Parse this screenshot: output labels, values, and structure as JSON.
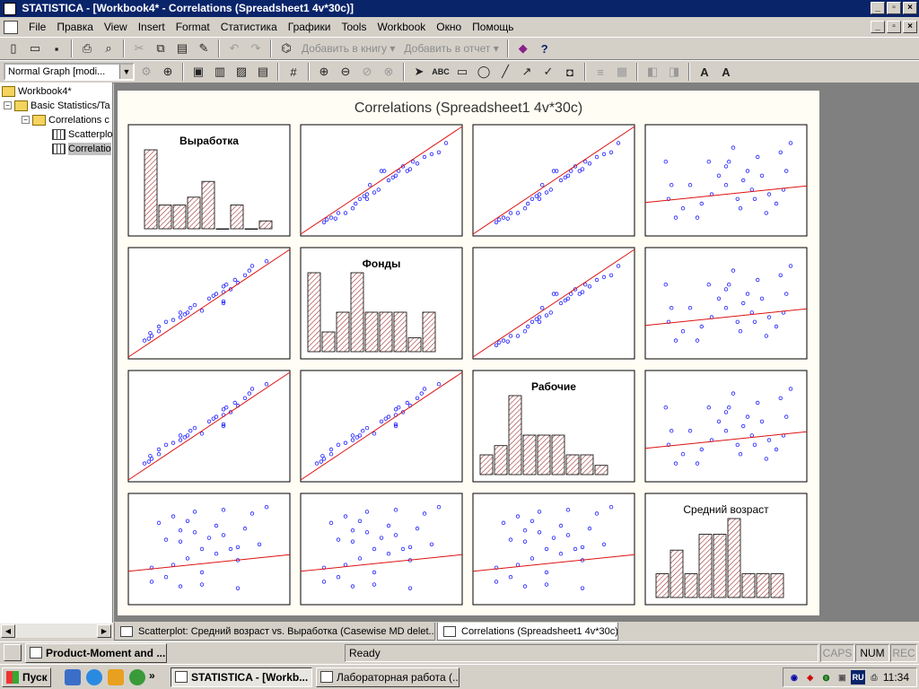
{
  "titlebar": {
    "title": "STATISTICA - [Workbook4* - Correlations (Spreadsheet1 4v*30c)]"
  },
  "menu": [
    "File",
    "Правка",
    "View",
    "Insert",
    "Format",
    "Статистика",
    "Графики",
    "Tools",
    "Workbook",
    "Окно",
    "Помощь"
  ],
  "toolbar1": {
    "add_to_workbook": "Добавить в книгу ▾",
    "add_to_report": "Добавить в отчет ▾"
  },
  "toolbar2": {
    "graph_style": "Normal Graph [modi..."
  },
  "tree": {
    "root": "Workbook4*",
    "basic_stats": "Basic Statistics/Ta",
    "correlations_folder": "Correlations c",
    "scatterplot": "Scatterplo",
    "correlations": "Correlatio"
  },
  "graph": {
    "title": "Correlations (Spreadsheet1 4v*30c)"
  },
  "chart_data": {
    "type": "scatter",
    "title": "Correlations (Spreadsheet1 4v*30c)",
    "variables": [
      "Выработка",
      "Фонды",
      "Рабочие",
      "Средний возраст"
    ],
    "histograms": [
      {
        "variable": "Выработка",
        "counts": [
          10,
          3,
          3,
          4,
          6,
          0,
          3,
          0,
          1
        ]
      },
      {
        "variable": "Фонды",
        "counts": [
          4,
          1,
          2,
          4,
          2,
          2,
          2,
          0.7,
          2
        ]
      },
      {
        "variable": "Рабочие",
        "counts": [
          1.5,
          2.2,
          6,
          3.0,
          3.0,
          3.0,
          1.5,
          1.5,
          0.7
        ]
      },
      {
        "variable": "Средний возраст",
        "counts": [
          1.5,
          3,
          1.5,
          4,
          4,
          5,
          1.5,
          1.5,
          1.5
        ]
      }
    ],
    "scatter_points": [
      [
        0.1,
        0.05
      ],
      [
        0.12,
        0.08
      ],
      [
        0.15,
        0.1
      ],
      [
        0.18,
        0.09
      ],
      [
        0.2,
        0.15
      ],
      [
        0.25,
        0.15
      ],
      [
        0.3,
        0.2
      ],
      [
        0.32,
        0.25
      ],
      [
        0.35,
        0.3
      ],
      [
        0.38,
        0.33
      ],
      [
        0.4,
        0.35
      ],
      [
        0.42,
        0.45
      ],
      [
        0.45,
        0.37
      ],
      [
        0.48,
        0.4
      ],
      [
        0.5,
        0.6
      ],
      [
        0.52,
        0.6
      ],
      [
        0.55,
        0.5
      ],
      [
        0.58,
        0.53
      ],
      [
        0.6,
        0.55
      ],
      [
        0.62,
        0.6
      ],
      [
        0.65,
        0.65
      ],
      [
        0.68,
        0.6
      ],
      [
        0.7,
        0.62
      ],
      [
        0.72,
        0.7
      ],
      [
        0.75,
        0.68
      ],
      [
        0.8,
        0.75
      ],
      [
        0.85,
        0.78
      ],
      [
        0.9,
        0.8
      ],
      [
        0.95,
        0.9
      ],
      [
        0.4,
        0.3
      ]
    ],
    "scatter_points_weak": [
      [
        0.08,
        0.7
      ],
      [
        0.1,
        0.3
      ],
      [
        0.12,
        0.45
      ],
      [
        0.15,
        0.1
      ],
      [
        0.2,
        0.2
      ],
      [
        0.25,
        0.45
      ],
      [
        0.3,
        0.1
      ],
      [
        0.33,
        0.25
      ],
      [
        0.38,
        0.7
      ],
      [
        0.4,
        0.35
      ],
      [
        0.45,
        0.55
      ],
      [
        0.5,
        0.45
      ],
      [
        0.52,
        0.7
      ],
      [
        0.55,
        0.85
      ],
      [
        0.58,
        0.3
      ],
      [
        0.6,
        0.2
      ],
      [
        0.62,
        0.5
      ],
      [
        0.65,
        0.6
      ],
      [
        0.68,
        0.4
      ],
      [
        0.7,
        0.3
      ],
      [
        0.72,
        0.75
      ],
      [
        0.75,
        0.55
      ],
      [
        0.78,
        0.15
      ],
      [
        0.8,
        0.35
      ],
      [
        0.85,
        0.25
      ],
      [
        0.88,
        0.8
      ],
      [
        0.9,
        0.4
      ],
      [
        0.92,
        0.6
      ],
      [
        0.95,
        0.9
      ],
      [
        0.5,
        0.65
      ]
    ]
  },
  "tabs": [
    "Scatterplot: Средний возраст vs. Выработка (Casewise MD delet...",
    "Correlations (Spreadsheet1 4v*30c)"
  ],
  "status": {
    "task": "Product-Moment and ...",
    "ready": "Ready",
    "caps": "CAPS",
    "num": "NUM",
    "rec": "REC"
  },
  "taskbar": {
    "start": "Пуск",
    "tasks": [
      "STATISTICA - [Workb...",
      "Лабораторная работа (..."
    ],
    "lang": "RU",
    "clock": "11:34"
  },
  "colors": {
    "titlebar": "#0a246a",
    "fit_line": "#d11",
    "points": "#1a1aff",
    "hist_fill": "#a03030"
  }
}
